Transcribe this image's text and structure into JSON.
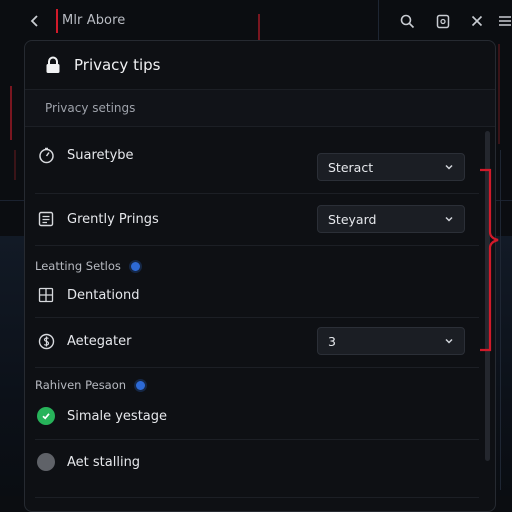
{
  "app": {
    "title": "Mlr Abore"
  },
  "panel": {
    "title": "Privacy tips",
    "section_label": "Privacy setings"
  },
  "rows": [
    {
      "label": "Suaretybe",
      "icon": "timer-icon",
      "select_value": "Steract"
    },
    {
      "label": "Grently Prings",
      "icon": "document-icon",
      "select_value": "Steyard"
    }
  ],
  "group1": {
    "heading": "Leatting Setlos",
    "item_label": "Dentationd",
    "select_label": "Aetegater",
    "select_value": "3"
  },
  "group2": {
    "heading": "Rahiven Pesaon",
    "toggle_on_label": "Simale yestage",
    "toggle_off_label": "Aet stalling"
  },
  "colors": {
    "accent_red": "#d11a2a",
    "info_blue": "#2d6ad6",
    "toggle_green": "#27b35a"
  }
}
